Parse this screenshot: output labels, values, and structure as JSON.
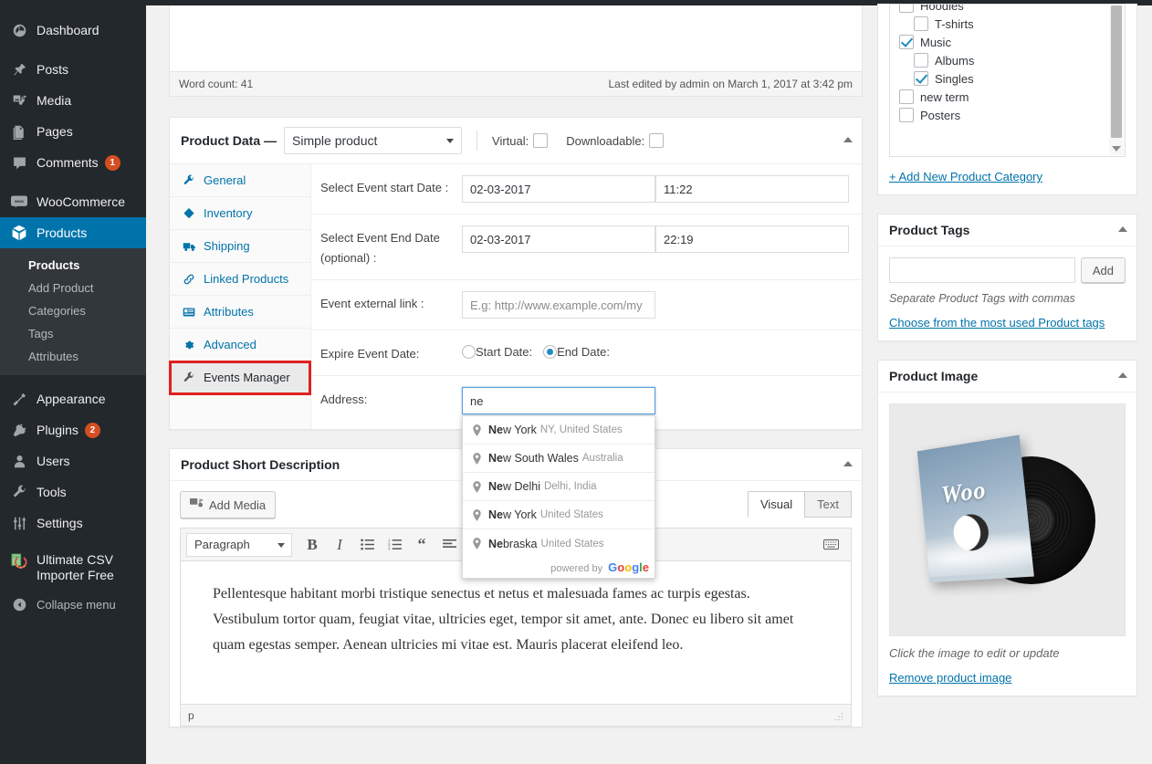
{
  "sidebar": {
    "items": [
      {
        "label": "Dashboard",
        "icon": "dashboard-icon",
        "name": "dashboard"
      },
      {
        "label": "Posts",
        "icon": "pin-icon",
        "name": "posts"
      },
      {
        "label": "Media",
        "icon": "media-icon",
        "name": "media"
      },
      {
        "label": "Pages",
        "icon": "pages-icon",
        "name": "pages"
      },
      {
        "label": "Comments",
        "icon": "comment-icon",
        "name": "comments",
        "badge": "1"
      },
      {
        "label": "WooCommerce",
        "icon": "woocommerce-icon",
        "name": "woocommerce"
      },
      {
        "label": "Products",
        "icon": "products-icon",
        "name": "products",
        "active": true
      },
      {
        "label": "Appearance",
        "icon": "appearance-icon",
        "name": "appearance"
      },
      {
        "label": "Plugins",
        "icon": "plugins-icon",
        "name": "plugins",
        "badge": "2"
      },
      {
        "label": "Users",
        "icon": "users-icon",
        "name": "users"
      },
      {
        "label": "Tools",
        "icon": "tools-icon",
        "name": "tools"
      },
      {
        "label": "Settings",
        "icon": "settings-icon",
        "name": "settings"
      },
      {
        "label": "Ultimate CSV Importer Free",
        "icon": "csv-importer-icon",
        "name": "csv-importer"
      },
      {
        "label": "Collapse menu",
        "icon": "collapse-icon",
        "name": "collapse-menu"
      }
    ],
    "products_submenu": [
      {
        "label": "Products",
        "current": true
      },
      {
        "label": "Add Product"
      },
      {
        "label": "Categories"
      },
      {
        "label": "Tags"
      },
      {
        "label": "Attributes"
      }
    ]
  },
  "description_editor": {
    "word_count": "Word count: 41",
    "last_edited": "Last edited by admin on March 1, 2017 at 3:42 pm"
  },
  "product_data": {
    "title": "Product Data —",
    "type_selected": "Simple product",
    "virtual_label": "Virtual:",
    "downloadable_label": "Downloadable:",
    "tabs": [
      {
        "label": "General",
        "icon": "wrench-icon"
      },
      {
        "label": "Inventory",
        "icon": "box-icon"
      },
      {
        "label": "Shipping",
        "icon": "truck-icon"
      },
      {
        "label": "Linked Products",
        "icon": "link-icon"
      },
      {
        "label": "Attributes",
        "icon": "list-icon"
      },
      {
        "label": "Advanced",
        "icon": "gear-icon"
      },
      {
        "label": "Events Manager",
        "icon": "wrench-icon",
        "highlighted": true
      }
    ],
    "fields": {
      "start_date_label": "Select Event start Date :",
      "start_date_value": "02-03-2017",
      "start_time_value": "11:22",
      "end_date_label": "Select Event End Date (optional) :",
      "end_date_value": "02-03-2017",
      "end_time_value": "22:19",
      "external_link_label": "Event external link :",
      "external_link_placeholder": "E.g: http://www.example.com/my",
      "expire_label": "Expire Event Date:",
      "expire_start_option": "Start Date:",
      "expire_end_option": "End Date:",
      "expire_selected": "End Date:",
      "address_label": "Address:",
      "address_value": "ne"
    },
    "autocomplete": {
      "suggestions": [
        {
          "match": "Ne",
          "main": "w York",
          "sub": "NY, United States"
        },
        {
          "match": "Ne",
          "main": "w South Wales",
          "sub": "Australia"
        },
        {
          "match": "Ne",
          "main": "w Delhi",
          "sub": "Delhi, India"
        },
        {
          "match": "Ne",
          "main": "w York",
          "sub": "United States"
        },
        {
          "match": "Ne",
          "main": "braska",
          "sub": "United States"
        }
      ],
      "powered_by": "powered by"
    }
  },
  "short_description": {
    "title": "Product Short Description",
    "add_media": "Add Media",
    "tab_visual": "Visual",
    "tab_text": "Text",
    "format_selected": "Paragraph",
    "body": "Pellentesque habitant morbi tristique senectus et netus et malesuada fames ac turpis egestas. Vestibulum tortor quam, feugiat vitae, ultricies eget, tempor sit amet, ante. Donec eu libero sit amet quam egestas semper. Aenean ultricies mi vitae est. Mauris placerat eleifend leo.",
    "statusbar_path": "p"
  },
  "product_category": {
    "items": [
      {
        "label": "Hoodies",
        "checked": false,
        "child": false
      },
      {
        "label": "T-shirts",
        "checked": false,
        "child": true
      },
      {
        "label": "Music",
        "checked": true,
        "child": false
      },
      {
        "label": "Albums",
        "checked": false,
        "child": true
      },
      {
        "label": "Singles",
        "checked": true,
        "child": true
      },
      {
        "label": "new term",
        "checked": false,
        "child": false
      },
      {
        "label": "Posters",
        "checked": false,
        "child": false
      }
    ],
    "add_link": "+ Add New Product Category"
  },
  "product_tags": {
    "title": "Product Tags",
    "input_value": "",
    "add_button": "Add",
    "hint": "Separate Product Tags with commas",
    "choose_link": "Choose from the most used Product tags"
  },
  "product_image": {
    "title": "Product Image",
    "alt": "Woo",
    "caption": "Click the image to edit or update",
    "remove_link": "Remove product image"
  },
  "colors": {
    "wp_blue": "#0073aa",
    "sidebar_bg": "#23282d",
    "submenu_bg": "#32373c",
    "badge": "#d54e21",
    "highlight_red": "#e02020",
    "link": "#0073aa"
  }
}
